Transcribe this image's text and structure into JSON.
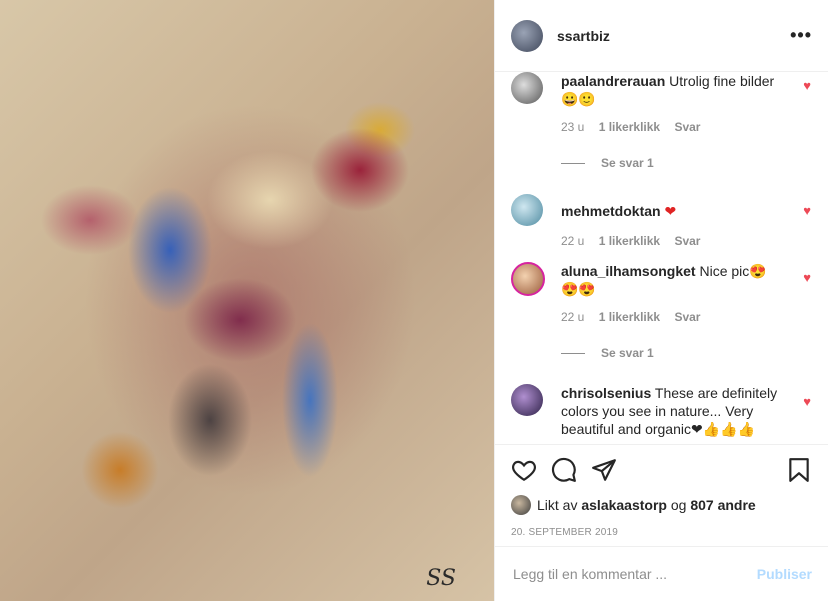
{
  "post": {
    "username": "ssartbiz",
    "more_glyph": "•••",
    "signature": "SS"
  },
  "comments": [
    {
      "username": "paalandrerauan",
      "text": "Utrolig fine bilder",
      "emoji_line": "😀🙂",
      "time": "23 u",
      "likes": "1 likerklikk",
      "reply": "Svar",
      "replies": "Se svar 1",
      "heart_icon": "heart-small-icon"
    },
    {
      "username": "mehmetdoktan",
      "text": "",
      "emoji_line": "❤",
      "time": "22 u",
      "likes": "1 likerklikk",
      "reply": "Svar",
      "heart_icon": "heart-small-icon"
    },
    {
      "username": "aluna_ilhamsongket",
      "text": "Nice pic",
      "emoji_line": "😍",
      "emoji_line2": "😍😍",
      "time": "22 u",
      "likes": "1 likerklikk",
      "reply": "Svar",
      "replies": "Se svar 1",
      "heart_icon": "heart-small-icon"
    },
    {
      "username": "chrisolsenius",
      "text": "These are definitely colors you see in nature... Very beautiful and organic",
      "emoji_line": "❤👍👍👍",
      "heart_icon": "heart-small-icon"
    }
  ],
  "actions": {
    "icons": [
      "heart-outline-icon",
      "comment-icon",
      "share-icon",
      "bookmark-icon"
    ]
  },
  "likes": {
    "prefix": "Likt av",
    "user": "aslakaastorp",
    "middle": "og",
    "count": "807 andre"
  },
  "date": "20. SEPTEMBER 2019",
  "add_comment": {
    "placeholder": "Legg til en kommentar ...",
    "post_label": "Publiser"
  },
  "colors": {
    "heart": "#ed4956",
    "muted": "#8e8e8e",
    "post_button_disabled": "#b3dbff"
  }
}
